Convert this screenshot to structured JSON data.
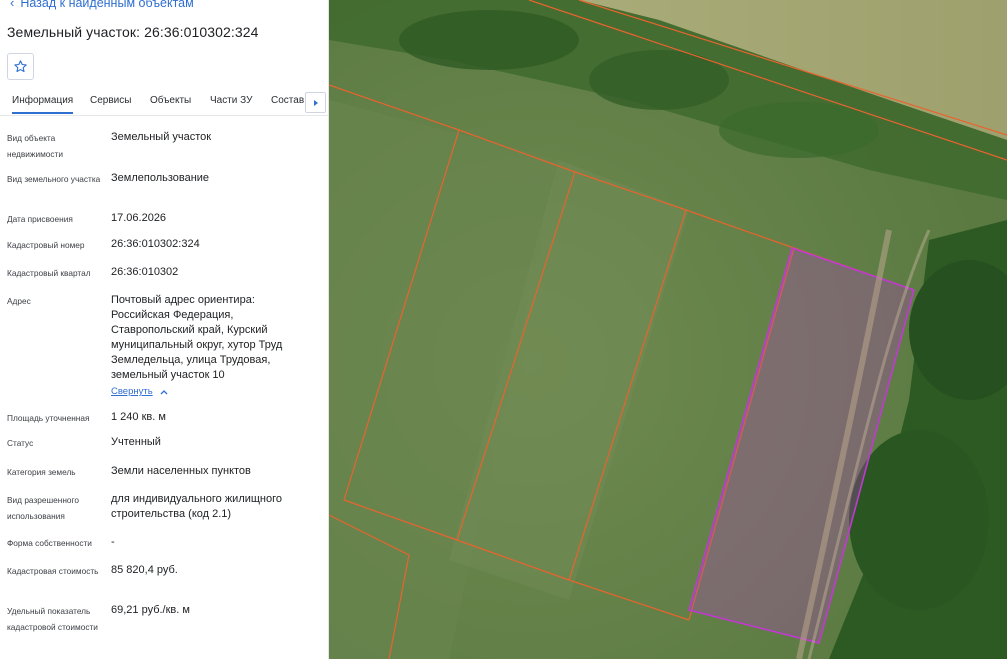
{
  "back_link": "Назад к найденным объектам",
  "title": "Земельный участок: 26:36:010302:324",
  "tabs": [
    {
      "label": "Информация"
    },
    {
      "label": "Сервисы"
    },
    {
      "label": "Объекты"
    },
    {
      "label": "Части ЗУ"
    },
    {
      "label": "Состав"
    }
  ],
  "collapse_label": "Свернуть",
  "fields": [
    {
      "label": "Вид объекта недвижимости",
      "value": "Земельный участок"
    },
    {
      "label": "Вид земельного участка",
      "value": "Землепользование"
    },
    {
      "label": "Дата присвоения",
      "value": "17.06.2026"
    },
    {
      "label": "Кадастровый номер",
      "value": "26:36:010302:324"
    },
    {
      "label": "Кадастровый квартал",
      "value": "26:36:010302"
    },
    {
      "label": "Адрес",
      "value": "Почтовый адрес ориентира: Российская Федерация, Ставропольский край, Курский муниципальный округ, хутор Труд Земледельца, улица Трудовая, земельный участок 10"
    },
    {
      "label": "Площадь уточненная",
      "value": "1 240 кв. м"
    },
    {
      "label": "Статус",
      "value": "Учтенный"
    },
    {
      "label": "Категория земель",
      "value": "Земли населенных пунктов"
    },
    {
      "label": "Вид разрешенного использования",
      "value": "для индивидуального жилищного строительства (код 2.1)"
    },
    {
      "label": "Форма собственности",
      "value": "-"
    },
    {
      "label": "Кадастровая стоимость",
      "value": "85 820,4 руб."
    },
    {
      "label": "Удельный показатель кадастровой стоимости",
      "value": "69,21 руб./кв. м"
    }
  ],
  "colors": {
    "accent": "#2f6fd1",
    "parcel_outline": "#e8642e",
    "selected_parcel": "#c03ad0"
  }
}
